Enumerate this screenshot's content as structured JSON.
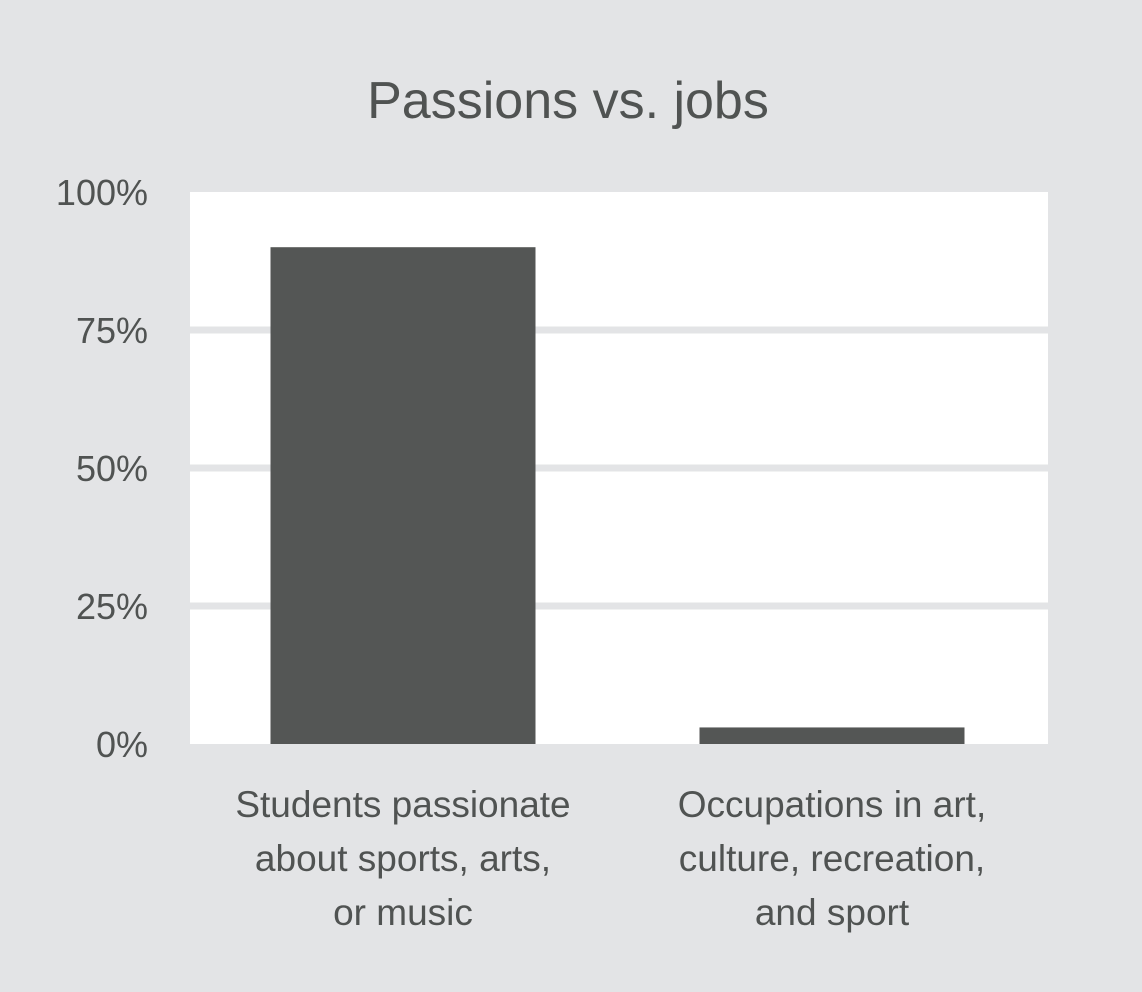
{
  "colors": {
    "background": "#e3e4e6",
    "plot_background": "#ffffff",
    "gridline": "#e3e4e6",
    "bar": "#545655",
    "text": "#505352"
  },
  "chart_data": {
    "type": "bar",
    "title": "Passions vs. jobs",
    "xlabel": "",
    "ylabel": "",
    "categories": [
      [
        "Students passionate",
        "about sports, arts,",
        "or music"
      ],
      [
        "Occupations in art,",
        "culture, recreation,",
        "and sport"
      ]
    ],
    "values": [
      90,
      3
    ],
    "ylim": [
      0,
      100
    ],
    "yticks": [
      0,
      25,
      50,
      75,
      100
    ],
    "ytick_labels": [
      "0%",
      "25%",
      "50%",
      "75%",
      "100%"
    ],
    "grid": true,
    "legend": "none"
  }
}
